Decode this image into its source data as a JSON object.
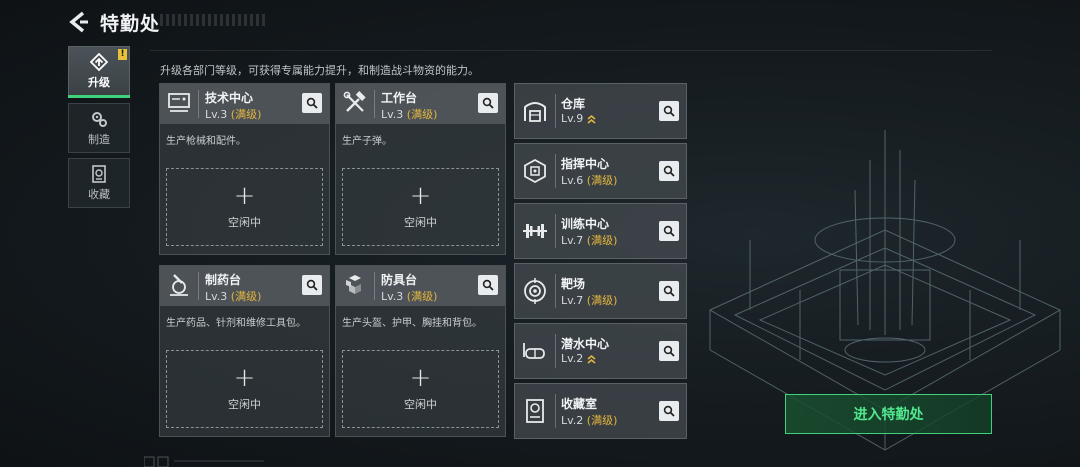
{
  "header": {
    "title": "特勤处"
  },
  "tabs": [
    {
      "label": "升级",
      "icon": "upgrade-icon",
      "active": true,
      "badge": "!"
    },
    {
      "label": "制造",
      "icon": "gears-icon",
      "active": false
    },
    {
      "label": "收藏",
      "icon": "collection-icon",
      "active": false
    }
  ],
  "description": "升级各部门等级，可获得专属能力提升，和制造战斗物资的能力。",
  "workshops": [
    {
      "name": "技术中心",
      "level": "Lv.3",
      "status": "(满级)",
      "desc": "生产枪械和配件。",
      "slot_label": "空闲中",
      "icon": "tech-center-icon"
    },
    {
      "name": "工作台",
      "level": "Lv.3",
      "status": "(满级)",
      "desc": "生产子弹。",
      "slot_label": "空闲中",
      "icon": "workbench-icon"
    },
    {
      "name": "制药台",
      "level": "Lv.3",
      "status": "(满级)",
      "desc": "生产药品、针剂和维修工具包。",
      "slot_label": "空闲中",
      "icon": "pharmacy-icon"
    },
    {
      "name": "防具台",
      "level": "Lv.3",
      "status": "(满级)",
      "desc": "生产头盔、护甲、胸挂和背包。",
      "slot_label": "空闲中",
      "icon": "armor-bench-icon"
    }
  ],
  "facilities": [
    {
      "name": "仓库",
      "level": "Lv.9",
      "status": "",
      "upgradable": true,
      "icon": "warehouse-icon"
    },
    {
      "name": "指挥中心",
      "level": "Lv.6",
      "status": "(满级)",
      "upgradable": false,
      "icon": "command-center-icon"
    },
    {
      "name": "训练中心",
      "level": "Lv.7",
      "status": "(满级)",
      "upgradable": false,
      "icon": "dumbbell-icon"
    },
    {
      "name": "靶场",
      "level": "Lv.7",
      "status": "(满级)",
      "upgradable": false,
      "icon": "target-icon"
    },
    {
      "name": "潜水中心",
      "level": "Lv.2",
      "status": "",
      "upgradable": true,
      "icon": "dive-mask-icon"
    },
    {
      "name": "收藏室",
      "level": "Lv.2",
      "status": "(满级)",
      "upgradable": false,
      "icon": "collection-room-icon"
    }
  ],
  "enter_button": "进入特勤处",
  "colors": {
    "accent_green": "#3fd27b",
    "maxed_gold": "#e3b53e",
    "badge_yellow": "#e8c13a"
  }
}
